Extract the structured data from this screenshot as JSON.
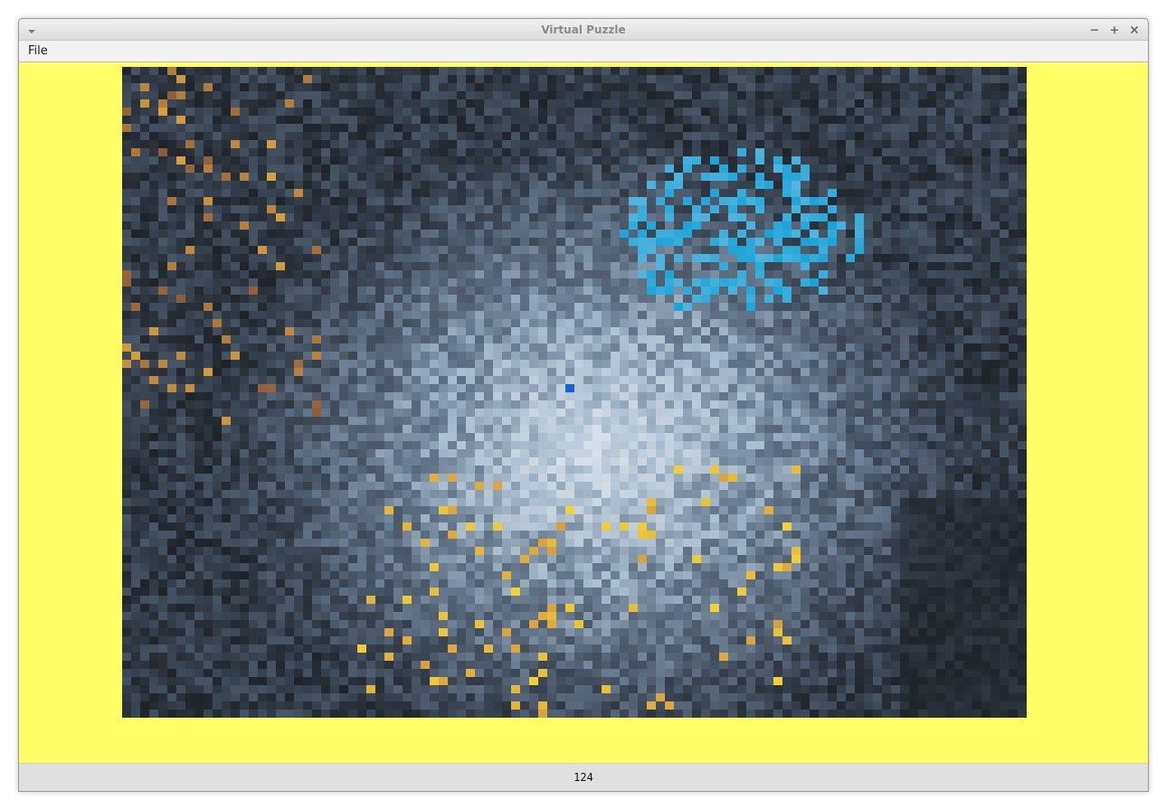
{
  "window": {
    "title": "Virtual Puzzle",
    "controls": [
      "minimize-icon",
      "maximize-icon",
      "close-icon"
    ]
  },
  "menubar": {
    "items": [
      {
        "label": "File"
      }
    ]
  },
  "board": {
    "background_color": "#fffe66",
    "image_description_icon": "scrambled-photo-tiles",
    "palette": {
      "dark": "#1e2329",
      "slate": "#3b4654",
      "steel": "#66788c",
      "light": "#a9bccd",
      "pale": "#d6e0ea",
      "warm": "#8a5a3c",
      "amber": "#d8a040",
      "yellow": "#f2d23a",
      "cyan": "#1aa3d8",
      "blue": "#1560e0"
    }
  },
  "status": {
    "value": "124"
  }
}
